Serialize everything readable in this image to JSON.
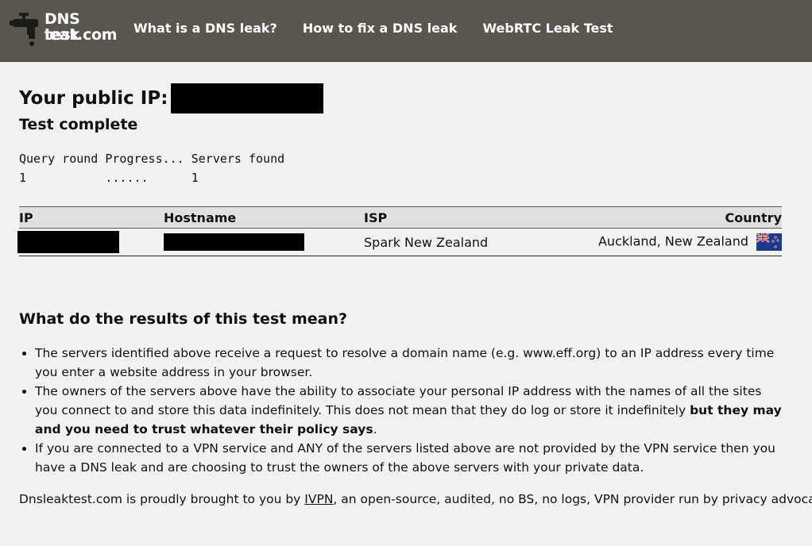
{
  "header": {
    "logo_line1": "DNS leak",
    "logo_line2": "test.com",
    "nav": [
      {
        "label": "What is a DNS leak?"
      },
      {
        "label": "How to fix a DNS leak"
      },
      {
        "label": "WebRTC Leak Test"
      }
    ]
  },
  "main": {
    "ip_label": "Your public IP:",
    "status": "Test complete",
    "query": {
      "headers": "Query round Progress... Servers found",
      "row": "1           ......      1"
    },
    "table": {
      "columns": [
        "IP",
        "Hostname",
        "ISP",
        "Country"
      ],
      "rows": [
        {
          "isp": "Spark New Zealand",
          "country": "Auckland, New Zealand",
          "flag": "new-zealand-flag"
        }
      ]
    },
    "results_heading": "What do the results of this test mean?",
    "points": [
      {
        "text": "The servers identified above receive a request to resolve a domain name (e.g. www.eff.org) to an IP address every time you enter a website address in your browser."
      },
      {
        "text": "The owners of the servers above have the ability to associate your personal IP address with the names of all the sites you connect to and store this data indefinitely. This does not mean that they do log or store it indefinitely ",
        "bold": "but they may and you need to trust whatever their policy says",
        "tail": "."
      },
      {
        "text": "If you are connected to a VPN service and ANY of the servers listed above are not provided by the VPN service then you have a DNS leak and are choosing to trust the owners of the above servers with your private data."
      }
    ],
    "footer": {
      "before": "Dnsleaktest.com is proudly brought to you by ",
      "link": "IVPN",
      "after": ", an open-source, audited, no BS, no logs, VPN provider run by privacy advocates."
    }
  },
  "colors": {
    "header_bg": "#59564f",
    "page_bg": "#f2f2f2",
    "table_header_bg": "#e0e0e0"
  }
}
